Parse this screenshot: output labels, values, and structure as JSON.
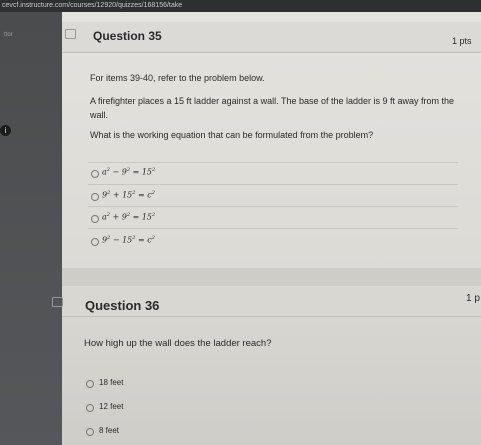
{
  "browser": {
    "url": "cevcf.instructure.com/courses/12920/quizzes/168156/take"
  },
  "sidebar": {
    "tiny_text": "ttor",
    "info_icon": "i"
  },
  "questions": [
    {
      "title": "Question 35",
      "points": "1 pts",
      "prompt": "For items 39-40, refer to the problem below.",
      "problem_line1": "A firefighter places a 15 ft ladder against a wall. The base of the ladder is 9 ft away from the",
      "problem_line2": "wall.",
      "question": "What is the working equation that can be formulated from the problem?",
      "options": [
        {
          "a": "a",
          "ea": "2",
          "op": " − ",
          "b": "9",
          "eb": "2",
          "eq": " = ",
          "c": "15",
          "ec": "2"
        },
        {
          "a": "9",
          "ea": "2",
          "op": " + ",
          "b": "15",
          "eb": "2",
          "eq": " = ",
          "c": "c",
          "ec": "2"
        },
        {
          "a": "a",
          "ea": "2",
          "op": " + ",
          "b": "9",
          "eb": "2",
          "eq": " = ",
          "c": "15",
          "ec": "2"
        },
        {
          "a": "9",
          "ea": "2",
          "op": " − ",
          "b": "15",
          "eb": "2",
          "eq": " = ",
          "c": "c",
          "ec": "2"
        }
      ]
    },
    {
      "title": "Question 36",
      "points": "1 p",
      "question": "How high up the wall does the ladder reach?",
      "options": [
        "18 feet",
        "12 feet",
        "8 feet"
      ]
    }
  ]
}
